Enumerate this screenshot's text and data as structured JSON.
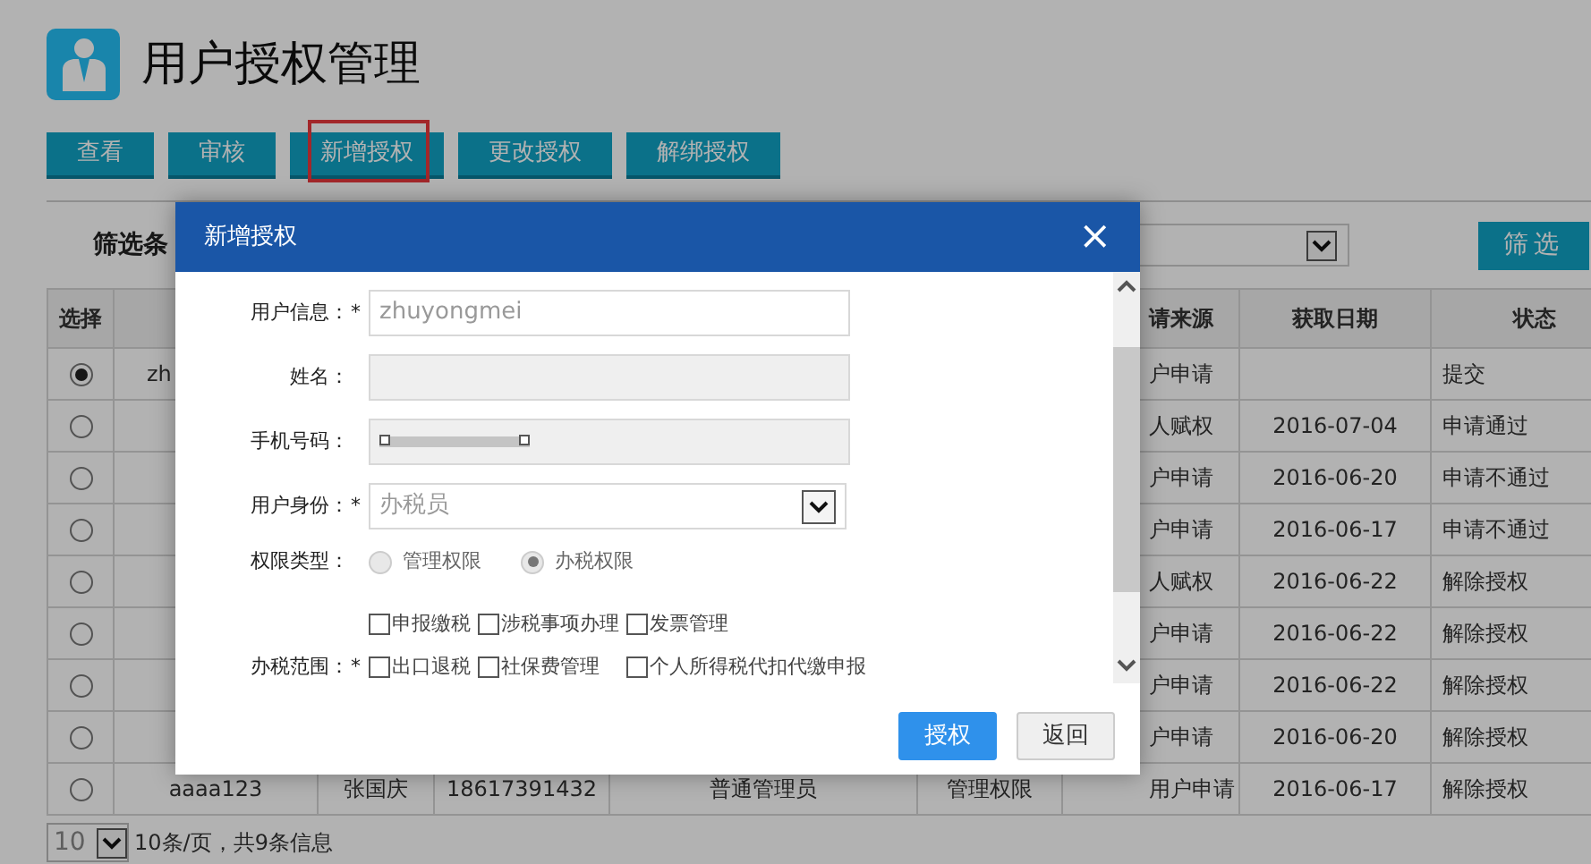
{
  "page": {
    "title": "用户授权管理"
  },
  "toolbar": [
    {
      "label": "查看",
      "highlighted": false
    },
    {
      "label": "审核",
      "highlighted": false
    },
    {
      "label": "新增授权",
      "highlighted": true
    },
    {
      "label": "更改授权",
      "highlighted": false
    },
    {
      "label": "解绑授权",
      "highlighted": false
    }
  ],
  "filter": {
    "label": "筛选条",
    "button": "筛选"
  },
  "table": {
    "header": {
      "select": "选择",
      "source": "请来源",
      "date": "获取日期",
      "status": "状态"
    },
    "rows": [
      {
        "selected": true,
        "user": "zh",
        "source": "户申请",
        "status": "提交"
      },
      {
        "selected": false,
        "source": "人赋权",
        "date": "2016-07-04",
        "status": "申请通过"
      },
      {
        "selected": false,
        "source": "户申请",
        "date": "2016-06-20",
        "status": "申请不通过"
      },
      {
        "selected": false,
        "source": "户申请",
        "date": "2016-06-17",
        "status": "申请不通过"
      },
      {
        "selected": false,
        "source": "人赋权",
        "date": "2016-06-22",
        "status": "解除授权"
      },
      {
        "selected": false,
        "source": "户申请",
        "date": "2016-06-22",
        "status": "解除授权"
      },
      {
        "selected": false,
        "source": "户申请",
        "date": "2016-06-22",
        "status": "解除授权"
      },
      {
        "selected": false,
        "source": "户申请",
        "date": "2016-06-20",
        "status": "解除授权"
      },
      {
        "selected": false,
        "user": "aaaa123",
        "name": "张国庆",
        "phone": "18617391432",
        "role": "普通管理员",
        "permission": "管理权限",
        "source": "用户申请",
        "date": "2016-06-17",
        "status": "解除授权"
      }
    ]
  },
  "pagination": {
    "page_size": "10",
    "summary": "10条/页，共9条信息"
  },
  "dialog": {
    "title": "新增授权",
    "close": "×",
    "fields": [
      {
        "kind": "text",
        "label": "用户信息：",
        "required_mark": "*",
        "disabled": false,
        "value": "zhuyongmei"
      },
      {
        "kind": "text",
        "label": "姓名：",
        "disabled": true
      },
      {
        "kind": "text",
        "label": "手机号码：",
        "disabled": true,
        "redacted": true
      },
      {
        "kind": "select",
        "label": "用户身份：",
        "required_mark": "*",
        "value": "办税员"
      },
      {
        "kind": "radio",
        "label": "权限类型：",
        "options": [
          {
            "label": "管理权限",
            "selected": false
          },
          {
            "label": "办税权限",
            "selected": true
          }
        ]
      },
      {
        "kind": "checkboxes",
        "label": "办税范围：",
        "required_mark": "*",
        "options": [
          {
            "label": "申报缴税",
            "checked": false
          },
          {
            "label": "涉税事项办理",
            "checked": false
          },
          {
            "label": "发票管理",
            "checked": false
          },
          {
            "label": "出口退税",
            "checked": false
          },
          {
            "label": "社保费管理",
            "checked": false
          },
          {
            "label": "个人所得税代扣代缴申报",
            "checked": false
          }
        ]
      }
    ],
    "buttons": [
      {
        "label": "授权",
        "kind": "primary"
      },
      {
        "label": "返回",
        "kind": "default"
      }
    ]
  }
}
